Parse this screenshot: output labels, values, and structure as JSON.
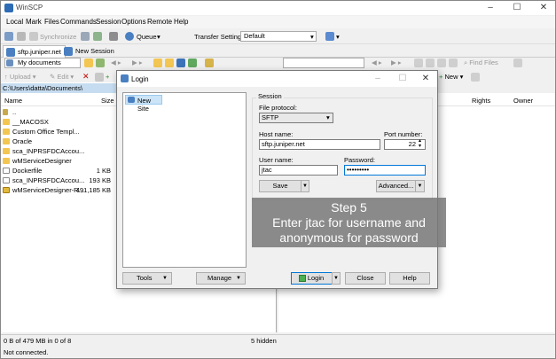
{
  "window": {
    "title": "WinSCP"
  },
  "menu": [
    "Local",
    "Mark",
    "Files",
    "Commands",
    "Session",
    "Options",
    "Remote",
    "Help"
  ],
  "toolbar": {
    "synchronize": "Synchronize",
    "queue": "Queue",
    "transfer_settings_label": "Transfer Settings",
    "transfer_settings_value": "Default"
  },
  "tabs": [
    {
      "label": "sftp.juniper.net"
    },
    {
      "label": "New Session"
    }
  ],
  "local": {
    "location": "My documents",
    "path": "C:\\Users\\datta\\Documents\\",
    "upload": "Upload",
    "edit": "Edit",
    "find_files": "Find Files",
    "new": "New",
    "columns": {
      "name": "Name",
      "size": "Size"
    },
    "files": [
      {
        "name": "..",
        "size": "",
        "kind": "up"
      },
      {
        "name": "__MACOSX",
        "size": "",
        "kind": "folder"
      },
      {
        "name": "Custom Office Templ...",
        "size": "",
        "kind": "folder"
      },
      {
        "name": "Oracle",
        "size": "",
        "kind": "folder"
      },
      {
        "name": "sca_INPRSFDCAccou...",
        "size": "",
        "kind": "folder"
      },
      {
        "name": "wMServiceDesigner",
        "size": "",
        "kind": "folder"
      },
      {
        "name": "Dockerfile",
        "size": "1 KB",
        "kind": "file"
      },
      {
        "name": "sca_INPRSFDCAccou...",
        "size": "193 KB",
        "kind": "file"
      },
      {
        "name": "wMServiceDesigner-R...",
        "size": "491,185 KB",
        "kind": "zip"
      }
    ]
  },
  "remote": {
    "columns": {
      "rights": "Rights",
      "owner": "Owner"
    }
  },
  "status": {
    "selection": "0 B of 479 MB in 0 of 8",
    "hidden": "5 hidden",
    "connection": "Not connected."
  },
  "login": {
    "title": "Login",
    "tree_item": "New Site",
    "session_label": "Session",
    "protocol_label": "File protocol:",
    "protocol_value": "SFTP",
    "host_label": "Host name:",
    "host_value": "sftp.juniper.net",
    "port_label": "Port number:",
    "port_value": "22",
    "user_label": "User name:",
    "user_value": "jtac",
    "password_label": "Password:",
    "password_value": "•••••••••",
    "save": "Save",
    "advanced": "Advanced...",
    "tools": "Tools",
    "manage": "Manage",
    "login_btn": "Login",
    "close": "Close",
    "help": "Help"
  },
  "overlay": {
    "line1": "Step 5",
    "line2": "Enter jtac for username and",
    "line3": "anonymous for password"
  },
  "colors": {
    "accent": "#0078d7",
    "path_bar": "#c6dcf0",
    "overlay": "#787878"
  }
}
